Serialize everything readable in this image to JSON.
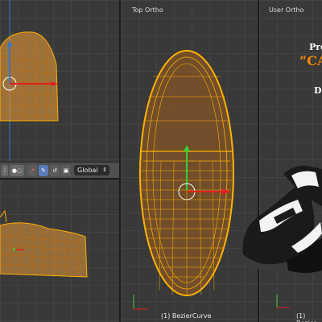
{
  "viewports": {
    "top_ortho_label": "Top Ortho",
    "user_ortho_label": "User Ortho",
    "object_name": "(1) BezierCurve",
    "object_name_right": "(1) Bezier"
  },
  "header": {
    "transform_orientation": "Global"
  },
  "overlay": {
    "line1": "Pre",
    "line2": "“CA",
    "line3": "D"
  },
  "colors": {
    "wire": "#f5a623",
    "accent": "#ff8a00",
    "grid_bg": "#393939"
  }
}
